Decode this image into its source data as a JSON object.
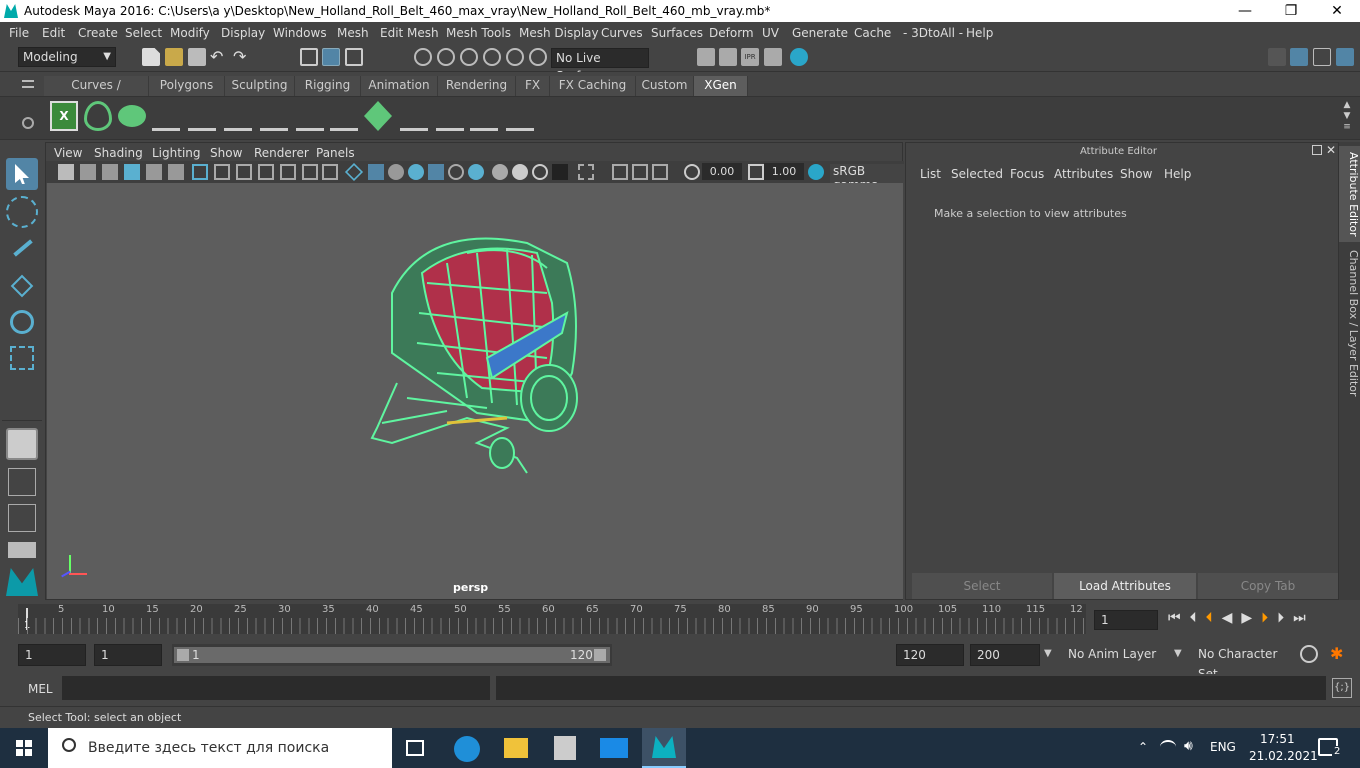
{
  "window": {
    "title": "Autodesk Maya 2016: C:\\Users\\a y\\Desktop\\New_Holland_Roll_Belt_460_max_vray\\New_Holland_Roll_Belt_460_mb_vray.mb*",
    "minimize": "—",
    "maximize": "❐",
    "close": "✕"
  },
  "menubar": [
    "File",
    "Edit",
    "Create",
    "Select",
    "Modify",
    "Display",
    "Windows",
    "Mesh",
    "Edit Mesh",
    "Mesh Tools",
    "Mesh Display",
    "Curves",
    "Surfaces",
    "Deform",
    "UV",
    "Generate",
    "Cache",
    "- 3DtoAll -",
    "Help"
  ],
  "statusline": {
    "mode": "Modeling",
    "live_surface": "No Live Surface"
  },
  "shelf_tabs": [
    "Curves / Surfaces",
    "Polygons",
    "Sculpting",
    "Rigging",
    "Animation",
    "Rendering",
    "FX",
    "FX Caching",
    "Custom",
    "XGen"
  ],
  "shelf_active": "XGen",
  "viewport": {
    "menu": [
      "View",
      "Shading",
      "Lighting",
      "Show",
      "Renderer",
      "Panels"
    ],
    "field1": "0.00",
    "field2": "1.00",
    "colorspace": "sRGB gamma",
    "camera_label": "persp"
  },
  "attribute_editor": {
    "title": "Attribute Editor",
    "menu": [
      "List",
      "Selected",
      "Focus",
      "Attributes",
      "Show",
      "Help"
    ],
    "message": "Make a selection to view attributes",
    "buttons": [
      "Select",
      "Load Attributes",
      "Copy Tab"
    ]
  },
  "side_tabs": [
    "Attribute Editor",
    "Channel Box / Layer Editor"
  ],
  "timeline": {
    "ticks": [
      "5",
      "10",
      "15",
      "20",
      "25",
      "30",
      "35",
      "40",
      "45",
      "50",
      "55",
      "60",
      "65",
      "70",
      "75",
      "80",
      "85",
      "90",
      "95",
      "100",
      "105",
      "110",
      "115",
      "12"
    ],
    "current_marker": "1",
    "current_frame": "1"
  },
  "range": {
    "start": "1",
    "playback_start": "1",
    "slider_start": "1",
    "slider_end": "120",
    "playback_end": "120",
    "end": "200",
    "anim_layer": "No Anim Layer",
    "character_set": "No Character Set"
  },
  "command": {
    "label": "MEL"
  },
  "help_line": "Select Tool: select an object",
  "taskbar": {
    "search_placeholder": "Введите здесь текст для поиска",
    "lang": "ENG",
    "time": "17:51",
    "date": "21.02.2021",
    "notifications": "2"
  },
  "colors": {
    "wireframe": "#5ff5a0",
    "accent_blue": "#5285a6",
    "panel": "#444444",
    "viewport_bg": "#5d5d5d"
  }
}
